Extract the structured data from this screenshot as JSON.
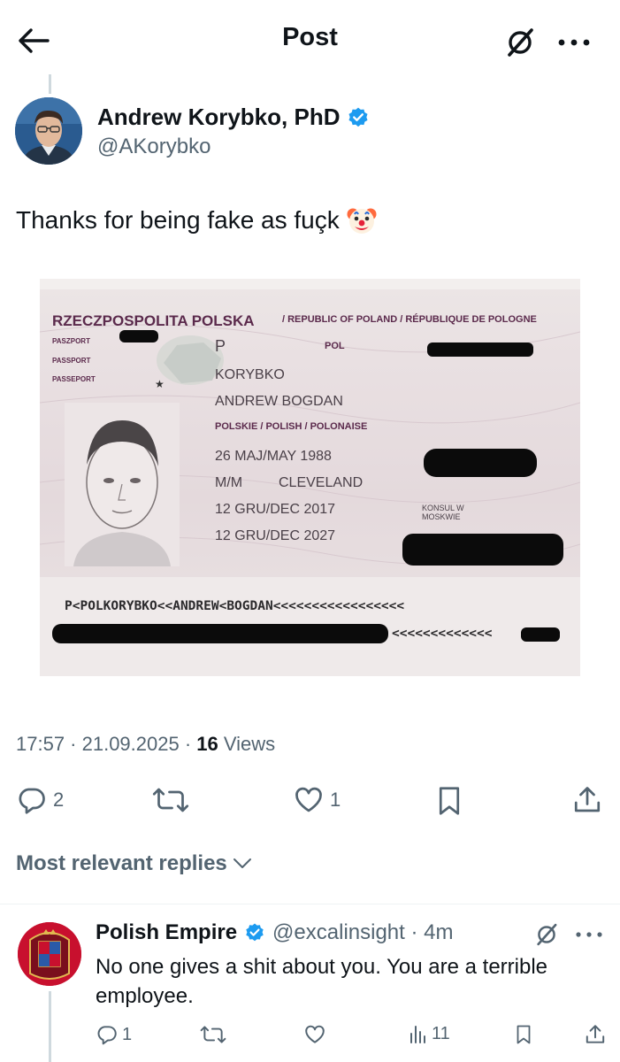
{
  "header": {
    "title": "Post"
  },
  "tweet": {
    "author_name": "Andrew Korybko, PhD",
    "author_handle": "@AKorybko",
    "text": "Thanks for being fake as fuçk",
    "emoji": "🤡",
    "timestamp": "17:57 · 21.09.2025 · ",
    "views_count": "16",
    "views_label": "Views",
    "replies": "2",
    "likes": "1"
  },
  "passport": {
    "country_pl": "RZECZPOSPOLITA POLSKA",
    "country_en_fr": "/ REPUBLIC OF POLAND / RÉPUBLIQUE DE POLOGNE",
    "doc_labels": [
      "PASZPORT",
      "PASSPORT",
      "PASSEPORT"
    ],
    "type": "P",
    "code": "POL",
    "surname": "KORYBKO",
    "given_names": "ANDREW BOGDAN",
    "nationality": "POLSKIE / POLISH / POLONAISE",
    "birth_date": "26 MAJ/MAY 1988",
    "sex": "M/M",
    "birth_place": "CLEVELAND",
    "issue_date": "12 GRU/DEC 2017",
    "expiry_date": "12 GRU/DEC 2027",
    "authority": "KONSUL W MOSKWIE",
    "mrz_line1": "P<POLKORYBKO<<ANDREW<BOGDAN<<<<<<<<<<<<<<<<<",
    "mrz_line2_visible": "<<<<<<<<<<<<<"
  },
  "replies_filter": {
    "label": "Most relevant replies"
  },
  "reply": {
    "author_name": "Polish Empire",
    "handle_time": "@excalinsight · 4m",
    "text": "No one gives a shit about you. You are a terrible employee.",
    "replies": "1",
    "views": "11"
  },
  "colors": {
    "verified": "#1d9bf0",
    "text_secondary": "#536471",
    "passport_ink": "#5b2a4c"
  }
}
